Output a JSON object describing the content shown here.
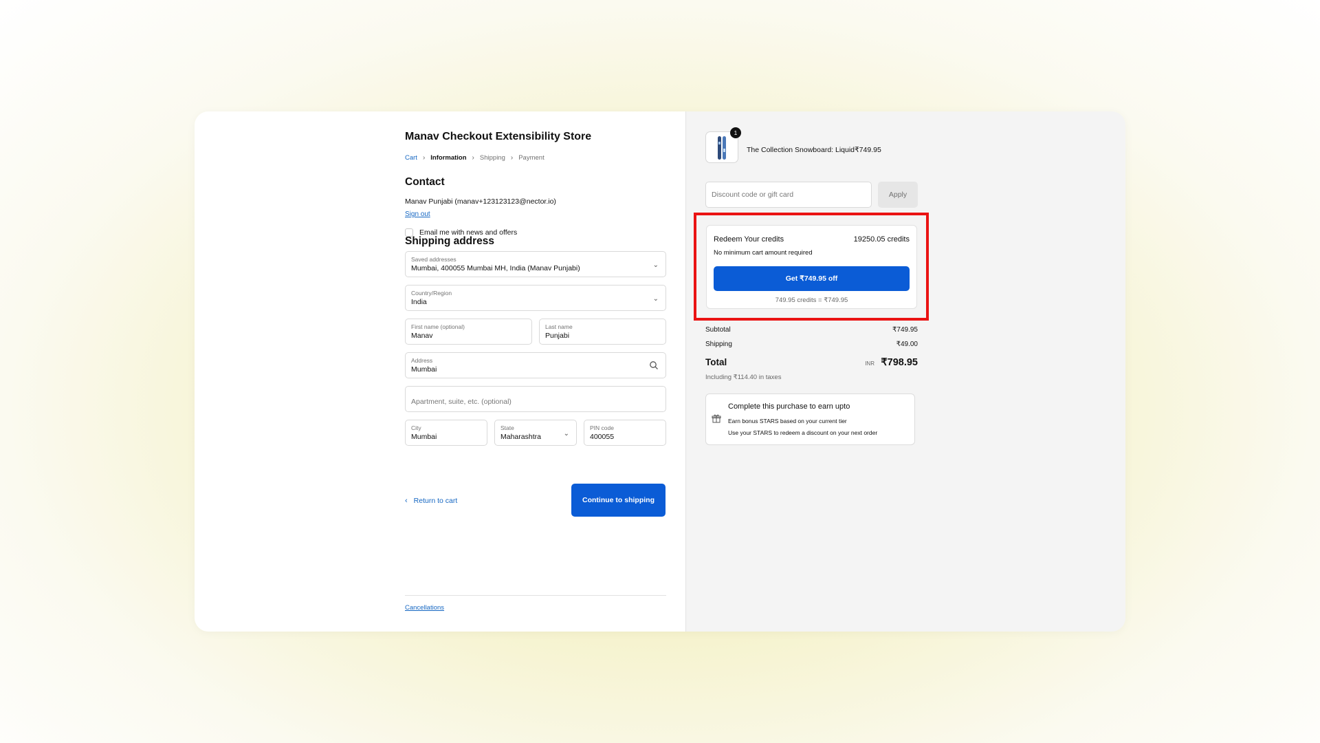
{
  "store": {
    "title": "Manav Checkout Extensibility Store"
  },
  "breadcrumb": {
    "cart": "Cart",
    "information": "Information",
    "shipping": "Shipping",
    "payment": "Payment"
  },
  "contact": {
    "heading": "Contact",
    "user": "Manav Punjabi (manav+123123123@nector.io)",
    "sign_out": "Sign out",
    "email_offers_label": "Email me with news and offers",
    "email_offers_checked": false
  },
  "shipping": {
    "heading": "Shipping address",
    "saved_addresses_label": "Saved addresses",
    "saved_addresses_value": "Mumbai, 400055 Mumbai MH, India (Manav Punjabi)",
    "country_label": "Country/Region",
    "country_value": "India",
    "first_name_label": "First name (optional)",
    "first_name_value": "Manav",
    "last_name_label": "Last name",
    "last_name_value": "Punjabi",
    "address_label": "Address",
    "address_value": "Mumbai",
    "apartment_placeholder": "Apartment, suite, etc. (optional)",
    "city_label": "City",
    "city_value": "Mumbai",
    "state_label": "State",
    "state_value": "Maharashtra",
    "pin_label": "PIN code",
    "pin_value": "400055"
  },
  "actions": {
    "return_to_cart": "Return to cart",
    "continue_to_shipping": "Continue to shipping"
  },
  "footer": {
    "cancellations": "Cancellations"
  },
  "order": {
    "quantity": "1",
    "product_name": "The Collection Snowboard: Liquid",
    "product_price": "₹749.95",
    "discount_placeholder": "Discount code or gift card",
    "apply_label": "Apply"
  },
  "redeem": {
    "title": "Redeem Your credits",
    "credits": "19250.05 credits",
    "subtitle": "No minimum cart amount required",
    "button": "Get ₹749.95 off",
    "conversion": "749.95 credits = ₹749.95"
  },
  "summary": {
    "subtotal_label": "Subtotal",
    "subtotal_value": "₹749.95",
    "shipping_label": "Shipping",
    "shipping_value": "₹49.00",
    "total_label": "Total",
    "currency": "INR",
    "total_value": "₹798.95",
    "taxes": "Including ₹114.40 in taxes"
  },
  "earn": {
    "title": "Complete this purchase to earn upto",
    "line1": "Earn bonus STARS based on your current tier",
    "line2": "Use your STARS to redeem a discount on your next order"
  },
  "colors": {
    "accent": "#0b5cd6",
    "link": "#1466c2",
    "highlight_border": "#ea1313"
  },
  "icons": {
    "chevron": "chevron-down-icon",
    "search": "search-icon",
    "back": "chevron-left-icon",
    "gift": "gift-icon",
    "product": "snowboard-thumbnail"
  }
}
